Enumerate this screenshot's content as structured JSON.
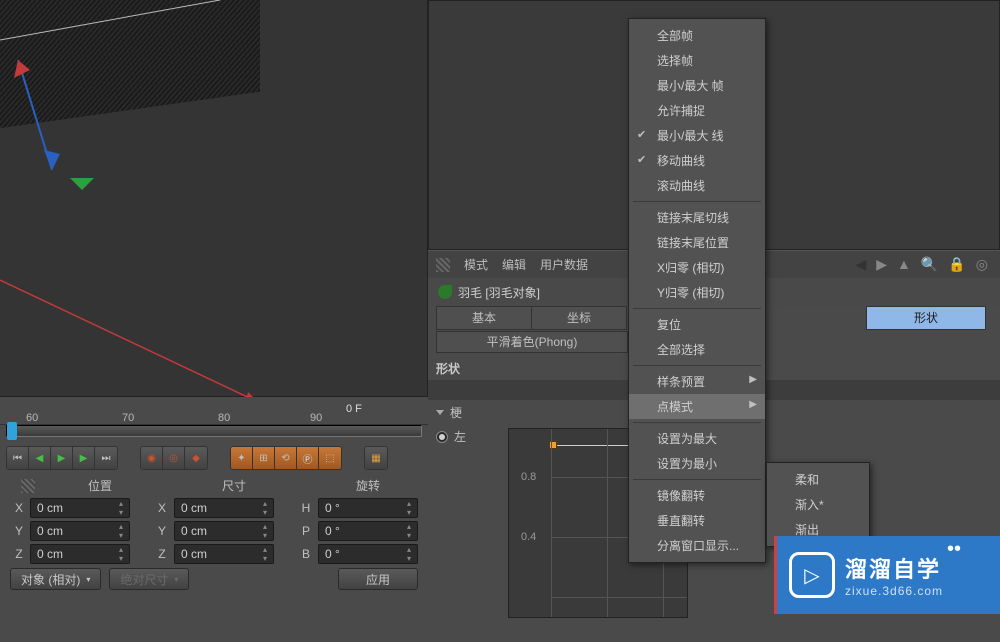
{
  "ruler": {
    "ticks": [
      "60",
      "70",
      "80",
      "90"
    ],
    "frame_label": "0 F"
  },
  "coords": {
    "head_pos": "位置",
    "head_size": "尺寸",
    "head_rot": "旋转",
    "rows": [
      {
        "axis": "X",
        "pos": "0 cm",
        "size_axis": "X",
        "size": "0 cm",
        "rot_axis": "H",
        "rot": "0 °"
      },
      {
        "axis": "Y",
        "pos": "0 cm",
        "size_axis": "Y",
        "size": "0 cm",
        "rot_axis": "P",
        "rot": "0 °"
      },
      {
        "axis": "Z",
        "pos": "0 cm",
        "size_axis": "Z",
        "size": "0 cm",
        "rot_axis": "B",
        "rot": "0 °"
      }
    ],
    "object_rel": "对象 (相对)",
    "abs_size": "绝对尺寸",
    "apply": "应用"
  },
  "attr": {
    "mode": "模式",
    "edit": "编辑",
    "userdata": "用户数据",
    "obj_title": "羽毛 [羽毛对象]",
    "tab_basic": "基本",
    "tab_coord": "坐标",
    "tab_shape": "形状",
    "tab_phong": "平滑着色(Phong)",
    "section_shape": "形状",
    "gan": "梗",
    "side_left": "左",
    "y08": "0.8",
    "y04": "0.4"
  },
  "menu": {
    "all_frames": "全部帧",
    "sel_frames": "选择帧",
    "minmax_frame": "最小/最大 帧",
    "allow_snap": "允许捕捉",
    "minmax_line": "最小/最大 线",
    "move_curve": "移动曲线",
    "scroll_curve": "滚动曲线",
    "link_tail_tang": "链接末尾切线",
    "link_tail_pos": "链接末尾位置",
    "xzero": "X归零 (相切)",
    "yzero": "Y归零 (相切)",
    "reset": "复位",
    "sel_all": "全部选择",
    "spline_preset": "样条预置",
    "point_mode": "点模式",
    "set_max": "设置为最大",
    "set_min": "设置为最小",
    "mirror_h": "镜像翻转",
    "mirror_v": "垂直翻转",
    "split_window": "分离窗口显示..."
  },
  "submenu": {
    "soft": "柔和",
    "ease_in": "渐入*",
    "ease_out": "渐出"
  },
  "watermark": {
    "name": "溜溜自学",
    "url": "zixue.3d66.com"
  },
  "colors": {
    "watermark_bg": "#2d79c7",
    "tab_active": "#8fb8e8"
  }
}
